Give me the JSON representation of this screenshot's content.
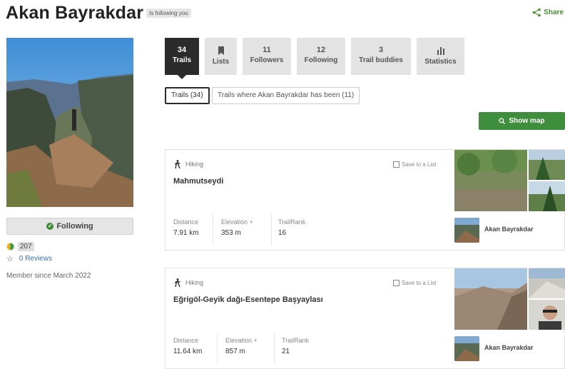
{
  "profile": {
    "name": "Akan Bayrakdar",
    "follow_badge": "Is following you",
    "share_label": "Share",
    "following_button": "Following",
    "points": "207",
    "reviews": "0 Reviews",
    "member_since": "Member since March 2022"
  },
  "tabs": [
    {
      "num": "34",
      "label": "Trails",
      "active": true
    },
    {
      "icon": "bookmark-icon",
      "label": "Lists"
    },
    {
      "num": "11",
      "label": "Followers"
    },
    {
      "num": "12",
      "label": "Following"
    },
    {
      "num": "3",
      "label": "Trail buddies"
    },
    {
      "icon": "bar-chart-icon",
      "label": "Statistics"
    }
  ],
  "subtabs": [
    {
      "label": "Trails (34)",
      "active": true
    },
    {
      "label": "Trails where Akan Bayrakdar has been (11)"
    }
  ],
  "show_map_label": "Show map",
  "trails": [
    {
      "activity": "Hiking",
      "save_label": "Save to a List",
      "name": "Mahmutseydi",
      "stats": [
        {
          "label": "Distance",
          "value": "7.91 km"
        },
        {
          "label": "Elevation +",
          "value": "353 m"
        },
        {
          "label": "TrailRank",
          "value": "16"
        }
      ],
      "author": "Akan Bayrakdar"
    },
    {
      "activity": "Hiking",
      "save_label": "Save to a List",
      "name": "Eğrigöl-Geyik dağı-Esentepe Başyaylası",
      "stats": [
        {
          "label": "Distance",
          "value": "11.64 km"
        },
        {
          "label": "Elevation +",
          "value": "857 m"
        },
        {
          "label": "TrailRank",
          "value": "21"
        }
      ],
      "author": "Akan Bayrakdar"
    }
  ],
  "colors": {
    "accent_green": "#3e8e3e",
    "tab_active": "#2b2b2b",
    "tab_bg": "#e3e3e3",
    "link_blue": "#3a6fb0"
  }
}
